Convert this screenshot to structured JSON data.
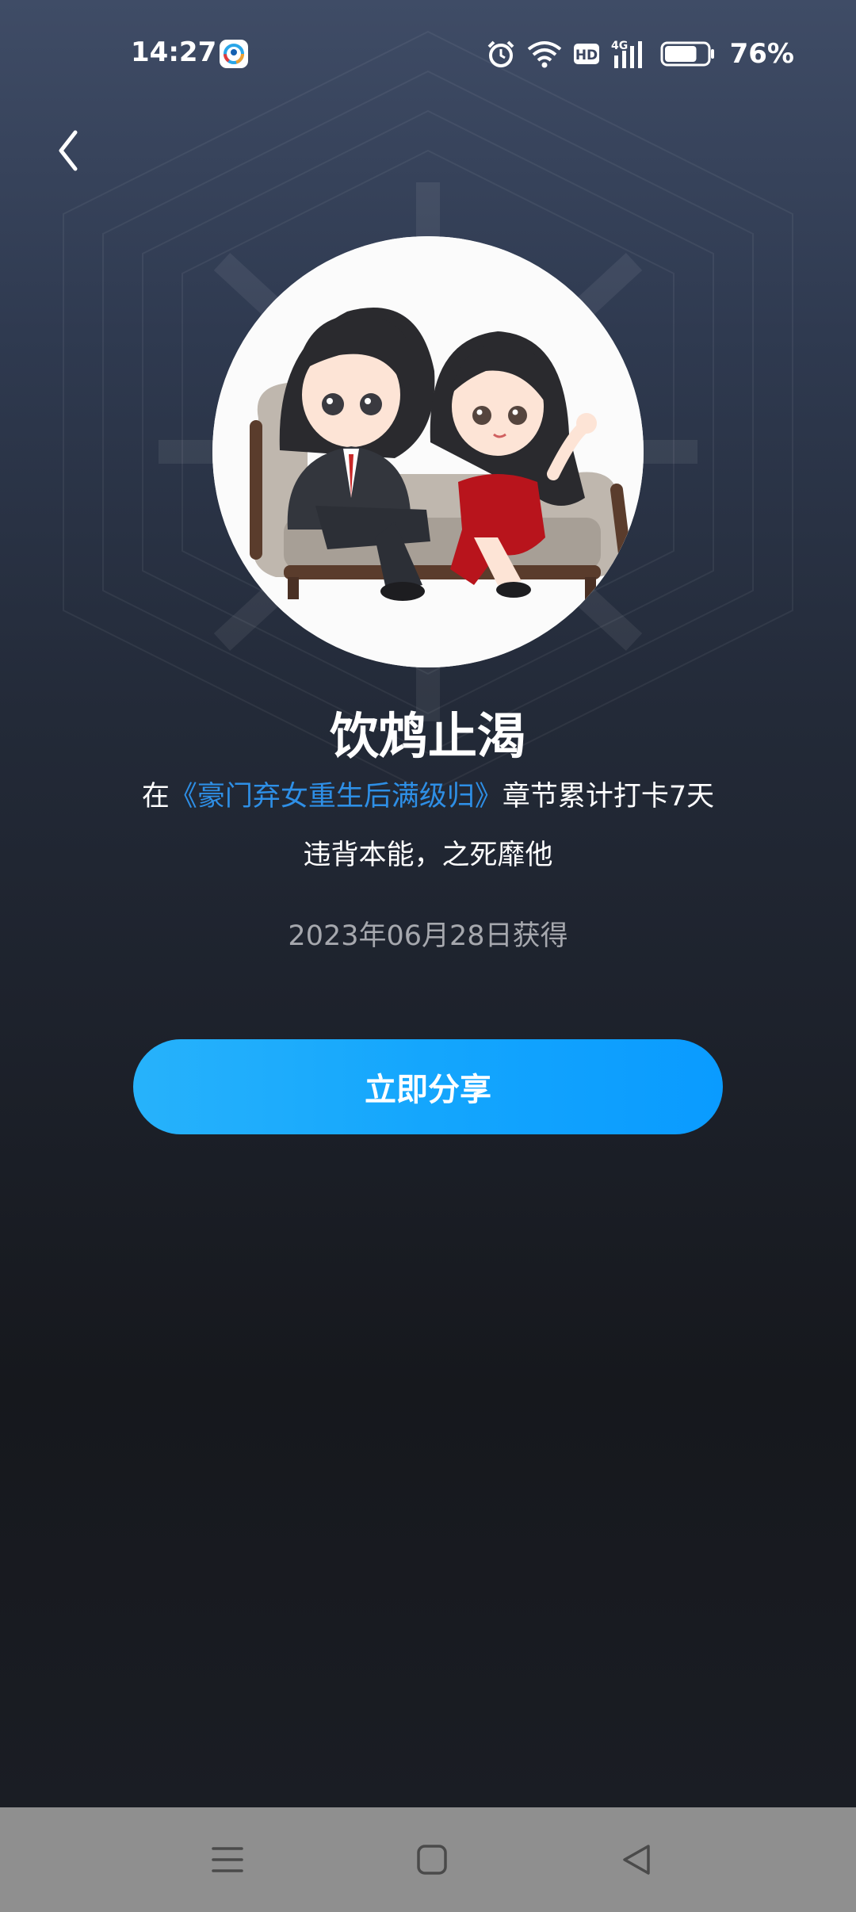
{
  "status_bar": {
    "time": "14:27",
    "battery_percent": "76%",
    "battery_level": 0.76,
    "network_badge": "HD",
    "network_type": "4G",
    "icons": [
      "alarm-icon",
      "wifi-icon",
      "hd-icon",
      "signal-4g-icon",
      "battery-icon"
    ]
  },
  "header": {
    "back_icon": "chevron-left-icon"
  },
  "badge": {
    "title": "饮鸩止渴",
    "desc_prefix": "在",
    "book_title": "《豪门弃女重生后满级归》",
    "desc_suffix": "章节累计打卡7天",
    "motto": "违背本能，之死靡他",
    "obtained_date": "2023年06月28日获得"
  },
  "actions": {
    "share_label": "立即分享"
  },
  "nav_bar": {
    "items": [
      "menu-icon",
      "home-icon",
      "back-triangle-icon"
    ]
  },
  "colors": {
    "accent": "#0a9bff",
    "link": "#2e8fe6",
    "date_text": "#a6a8ae",
    "bg_top": "#3f4c66",
    "bg_bottom": "#16181d"
  }
}
